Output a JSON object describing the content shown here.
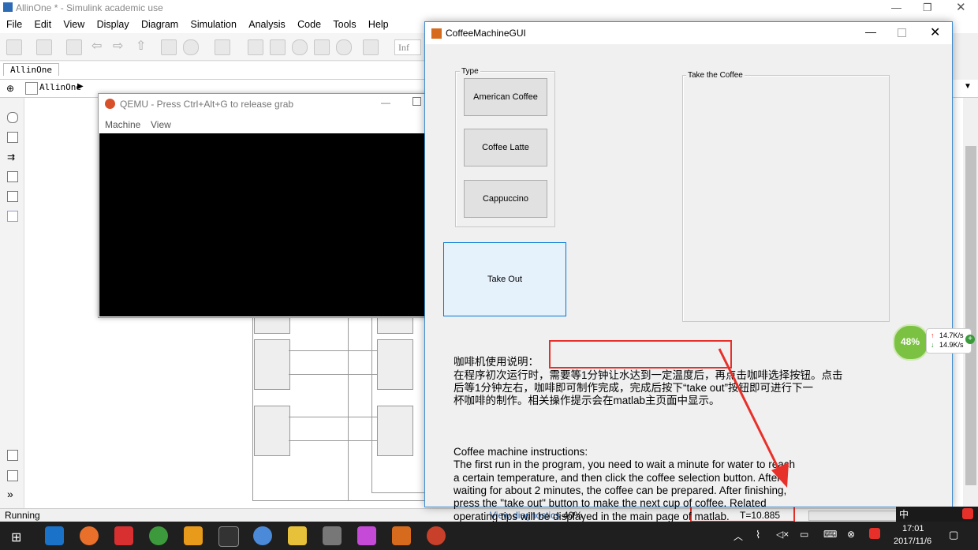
{
  "simulink": {
    "title": "AllinOne * - Simulink academic use",
    "menu": [
      "File",
      "Edit",
      "View",
      "Display",
      "Diagram",
      "Simulation",
      "Analysis",
      "Code",
      "Tools",
      "Help"
    ],
    "tab": "AllinOne",
    "breadcrumb": "AllinOne",
    "zoom_field": "Inf",
    "status_left": "Running",
    "status_diag": "View diagnostics",
    "status_pct": "40%",
    "status_time": "T=10.885"
  },
  "qemu": {
    "title": "QEMU - Press Ctrl+Alt+G to release grab",
    "menu": [
      "Machine",
      "View"
    ]
  },
  "gui": {
    "title": "CoffeeMachineGUI",
    "type_panel_label": "Type",
    "buttons": [
      "American Coffee",
      "Coffee Latte",
      "Cappuccino"
    ],
    "takeout_label": "Take Out",
    "coffee_panel_label": "Take the Coffee",
    "instructions_cn": "咖啡机使用说明：\n在程序初次运行时，需要等1分钟让水达到一定温度后，再点击咖啡选择按钮。点击\n后等1分钟左右，咖啡即可制作完成，完成后按下“take out”按钮即可进行下一\n杯咖啡的制作。相关操作提示会在matlab主页面中显示。",
    "instructions_en": "Coffee machine instructions:\nThe first run in the program, you need to wait a minute for water to reach\na certain temperature, and then click the coffee selection button. After\nwaiting for about 2 minutes, the coffee can be prepared. After finishing,\npress the \"take out\" button to make the next cup of coffee. Related\noperating tips will be displayed in the main page of matlab."
  },
  "netmeter": {
    "percent": "48%",
    "up": "14.7K/s",
    "down": "14.9K/s"
  },
  "taskbar": {
    "time": "17:01",
    "date": "2017/11/6",
    "ime": "中"
  },
  "colors": {
    "highlight_red": "#e8302a",
    "accent_blue": "#3c8bd0",
    "meter_green": "#7cc242"
  }
}
